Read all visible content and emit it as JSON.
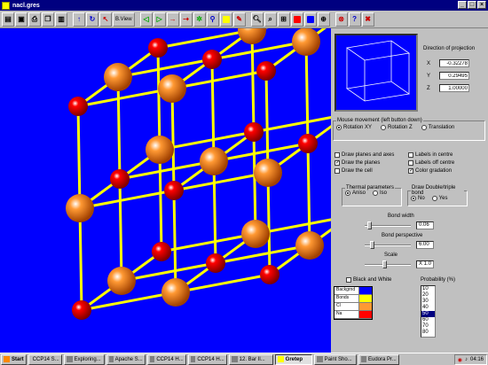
{
  "window": {
    "title": "nacl.gres"
  },
  "toolbar": {
    "bview_label": "B.View"
  },
  "projection": {
    "heading": "Direction of projection",
    "x_label": "X",
    "y_label": "Y",
    "z_label": "Z",
    "x_value": "-0.32278",
    "y_value": "0.29495",
    "z_value": "1.00000"
  },
  "mouse": {
    "legend": "Mouse movement (left button down)",
    "options": [
      {
        "label": "Rotation XY",
        "selected": true
      },
      {
        "label": "Rotation Z",
        "selected": false
      },
      {
        "label": "Translation",
        "selected": false
      }
    ]
  },
  "checks": {
    "planes_axes": "Draw planes and axes",
    "draw_planes": "Draw the planes",
    "draw_cell": "Draw the cell",
    "labels_centre": "Labels in centre",
    "labels_offcentre": "Labels off centre",
    "color_gradation": "Color gradation"
  },
  "thermal": {
    "legend": "Thermal parameters",
    "anisi": "Aniso",
    "iso": "Iso"
  },
  "bond_draw": {
    "legend": "Draw Double/triple bond",
    "no": "No",
    "yes": "Yes"
  },
  "bond_width": {
    "label": "Bond width",
    "value": "0.06"
  },
  "bond_persp": {
    "label": "Bond perspective",
    "value": "6.00"
  },
  "scale": {
    "label": "Scale",
    "value": "X 1.0"
  },
  "bw": {
    "label": "Black and White"
  },
  "probability": {
    "label": "Probability (%)",
    "options": [
      "10",
      "20",
      "30",
      "40",
      "50",
      "60",
      "70",
      "80",
      "90"
    ],
    "selected": "50"
  },
  "legend_rows": [
    {
      "name": "Backgrnd",
      "color": "#0000ff"
    },
    {
      "name": "Bonds",
      "color": "#ffff00"
    },
    {
      "name": "Cl",
      "color": "#ff9933"
    },
    {
      "name": "Na",
      "color": "#ff0000"
    }
  ],
  "taskbar": {
    "start": "Start",
    "items": [
      "CCP14 S...",
      "Exploring...",
      "Apache S...",
      "CCP14 H...",
      "CCP14 H...",
      "12. Bar Il...",
      "Gretep",
      "Paint Sho...",
      "Eudora Pr..."
    ],
    "active": "Gretep",
    "clock": "04:16"
  },
  "colors": {
    "na": "#ff0000",
    "cl": "#ff9933",
    "bond": "#ffff00",
    "bg": "#0000ff"
  }
}
